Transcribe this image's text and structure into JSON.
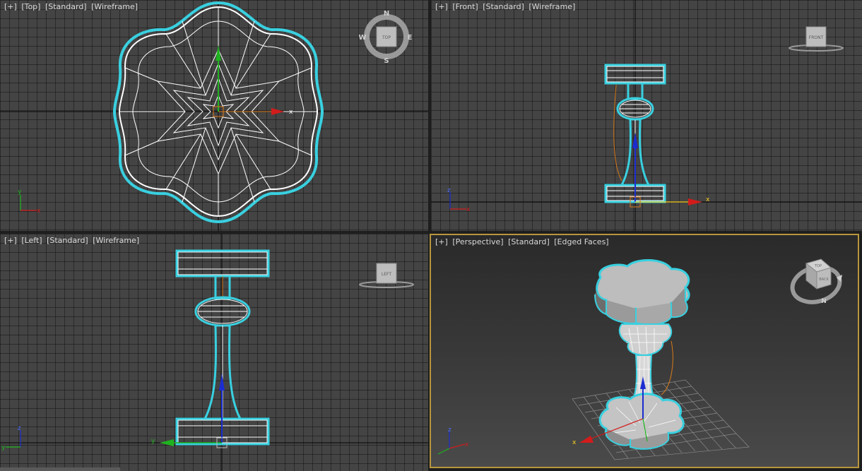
{
  "viewports": {
    "top": {
      "labels": [
        "[+]",
        "[Top]",
        "[Standard]",
        "[Wireframe]"
      ],
      "compass": {
        "n": "N",
        "s": "S",
        "e": "E",
        "w": "W",
        "cube": "TOP"
      }
    },
    "front": {
      "labels": [
        "[+]",
        "[Front]",
        "[Standard]",
        "[Wireframe]"
      ],
      "cube": "FRONT"
    },
    "left": {
      "labels": [
        "[+]",
        "[Left]",
        "[Standard]",
        "[Wireframe]"
      ],
      "cube": "LEFT"
    },
    "perspective": {
      "labels": [
        "[+]",
        "[Perspective]",
        "[Standard]",
        "[Edged Faces]"
      ],
      "cube_top": "TOP",
      "cube_front": "BACK",
      "compass_n": "N"
    }
  },
  "axes": {
    "x": "x",
    "y": "y",
    "z": "z"
  },
  "colors": {
    "viewport_bg": "#444444",
    "active_border": "#b8963e",
    "selection_outline": "#39d0e0",
    "wire": "#ffffff",
    "axis_x": "#d21c1c",
    "axis_y": "#1fb31f",
    "axis_z": "#1b2dd0"
  }
}
